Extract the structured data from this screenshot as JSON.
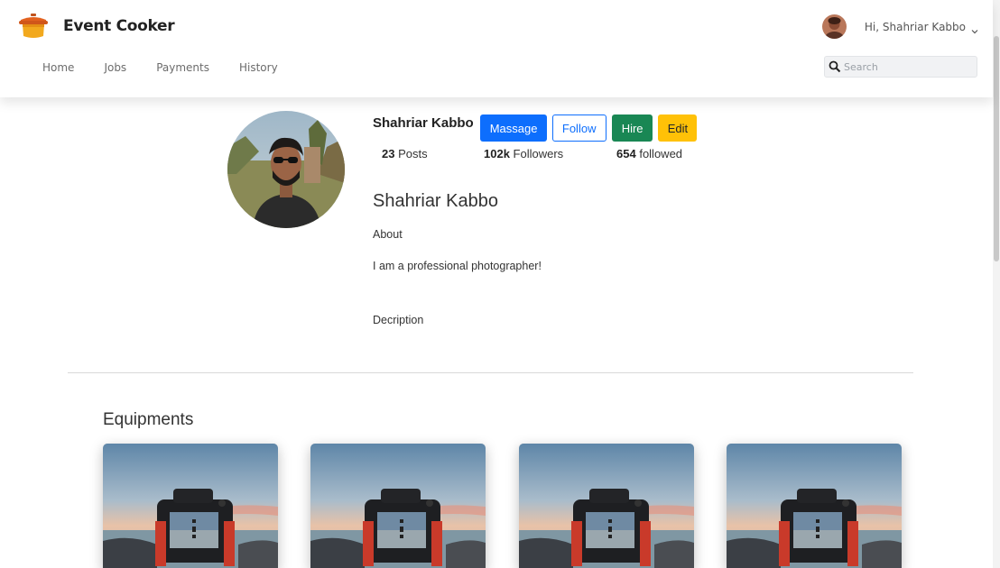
{
  "brand": {
    "name": "Event Cooker",
    "icon": "cooking-pot-icon"
  },
  "nav": {
    "items": [
      "Home",
      "Jobs",
      "Payments",
      "History"
    ]
  },
  "user": {
    "greeting": "Hi, Shahriar Kabbo"
  },
  "search": {
    "placeholder": "Search"
  },
  "profile": {
    "username": "Shahriar Kabbo",
    "buttons": {
      "message": "Massage",
      "follow": "Follow",
      "hire": "Hire",
      "edit": "Edit"
    },
    "stats": {
      "posts_count": "23",
      "posts_label": "Posts",
      "followers_count": "102k",
      "followers_label": "Followers",
      "followed_count": "654",
      "followed_label": "followed"
    },
    "display_name": "Shahriar Kabbo",
    "about_label": "About",
    "about_text": "I am a professional photographer!",
    "description_label": "Decription"
  },
  "equipments": {
    "title": "Equipments",
    "items": [
      {
        "image": "camera-photo"
      },
      {
        "image": "camera-photo"
      },
      {
        "image": "camera-photo"
      },
      {
        "image": "camera-photo"
      }
    ]
  },
  "colors": {
    "primary": "#0d6efd",
    "success": "#198754",
    "warning": "#ffc107"
  }
}
